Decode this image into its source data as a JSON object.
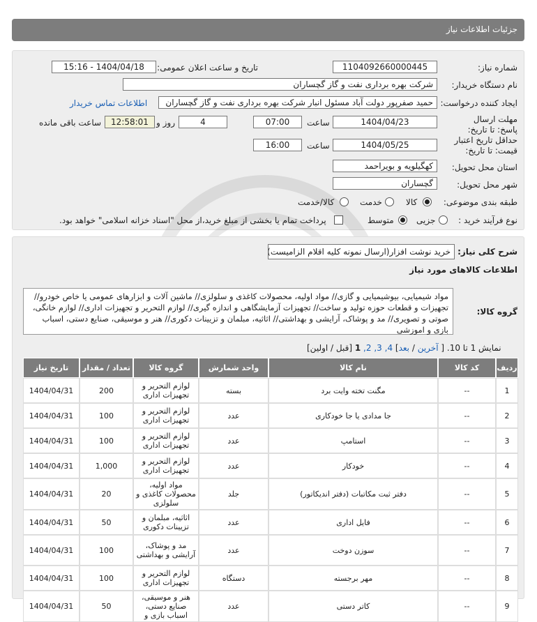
{
  "header": {
    "title": "جزئیات اطلاعات نیاز"
  },
  "form": {
    "need_number_label": "شماره نیاز:",
    "need_number": "1104092660000445",
    "announce_label": "تاریخ و ساعت اعلان عمومی:",
    "announce_value": "1404/04/18 - 15:16",
    "buyer_org_label": "نام دستگاه خریدار:",
    "buyer_org": "شرکت بهره برداری نفت و گاز گچساران",
    "requester_label": "ایجاد کننده درخواست:",
    "requester": "حمید  صفرپور دولت آباد مسئول انبار شرکت بهره برداری نفت و گاز گچساران",
    "buyer_contact_link": "اطلاعات تماس خریدار",
    "reply_deadline_label": "مهلت ارسال پاسخ: تا تاریخ:",
    "reply_date": "1404/04/23",
    "time_label": "ساعت",
    "reply_time": "07:00",
    "days_value": "4",
    "days_label": "روز و",
    "remaining_time": "12:58:01",
    "remaining_label": "ساعت باقی مانده",
    "price_validity_label": "حداقل تاریخ اعتبار قیمت: تا تاریخ:",
    "price_date": "1404/05/25",
    "price_time": "16:00",
    "province_label": "استان محل تحویل:",
    "province": "کهگیلویه و بویراحمد",
    "city_label": "شهر محل تحویل:",
    "city": "گچساران",
    "category_label": "طبقه بندی موضوعی:",
    "category_options": [
      "کالا",
      "خدمت",
      "کالا/خدمت"
    ],
    "category_selected": "کالا",
    "process_label": "نوع فرآیند خرید :",
    "process_options": [
      "جزیی",
      "متوسط"
    ],
    "process_selected": "متوسط",
    "treasury_note": "پرداخت تمام یا بخشی از مبلغ خرید،از محل \"اسناد خزانه اسلامی\" خواهد بود."
  },
  "details": {
    "summary_label": "شرح کلی نیاز:",
    "summary": "خرید نوشت افزار(ارسال نمونه کلیه اقلام الزامیست)",
    "goods_info_title": "اطلاعات کالاهای مورد نیاز",
    "goods_group_label": "گروه کالا:",
    "goods_group": "مواد شیمیایی، بیوشیمیایی و گازی// مواد اولیه، محصولات کاغذی و سلولزی// ماشین آلات و ابزارهای عمومی یا خاص خودرو// تجهیزات و قطعات حوزه تولید و ساخت// تجهیزات آزمایشگاهی و اندازه گیری// لوازم التحریر و تجهیزات اداری// لوازم خانگی، صوتی و تصویری// مد و پوشاک، آرایشی و بهداشتی// اثاثیه، مبلمان و تزیینات دکوری// هنر و موسیقی، صنایع دستی، اسباب بازی و اموزشی"
  },
  "pager": {
    "showing": "نمایش 1 تا 10.",
    "last": "آخرین",
    "next": "بعد",
    "pages": "4, 3, 2,",
    "current": "1",
    "prev_first": "[قبل / اولین]"
  },
  "table": {
    "headers": [
      "ردیف",
      "کد کالا",
      "نام کالا",
      "واحد شمارش",
      "گروه کالا",
      "تعداد / مقدار",
      "تاریخ نیاز"
    ],
    "rows": [
      [
        "1",
        "--",
        "مگنت تخته وایت برد",
        "بسته",
        "لوازم التحریر و تجهیزات اداری",
        "200",
        "1404/04/31"
      ],
      [
        "2",
        "--",
        "جا مدادی یا جا خودکاری",
        "عدد",
        "لوازم التحریر و تجهیزات اداری",
        "100",
        "1404/04/31"
      ],
      [
        "3",
        "--",
        "استامپ",
        "عدد",
        "لوازم التحریر و تجهیزات اداری",
        "100",
        "1404/04/31"
      ],
      [
        "4",
        "--",
        "خودکار",
        "عدد",
        "لوازم التحریر و تجهیزات اداری",
        "1,000",
        "1404/04/31"
      ],
      [
        "5",
        "--",
        "دفتر ثبت مکاتبات (دفتر اندیکاتور)",
        "جلد",
        "مواد اولیه، محصولات کاغذی و سلولزی",
        "20",
        "1404/04/31"
      ],
      [
        "6",
        "--",
        "فایل اداری",
        "عدد",
        "اثاثیه، مبلمان و تزیینات دکوری",
        "50",
        "1404/04/31"
      ],
      [
        "7",
        "--",
        "سوزن دوخت",
        "عدد",
        "مد و پوشاک، آرایشی و بهداشتی",
        "100",
        "1404/04/31"
      ],
      [
        "8",
        "--",
        "مهر برجسته",
        "دستگاه",
        "لوازم التحریر و تجهیزات اداری",
        "100",
        "1404/04/31"
      ],
      [
        "9",
        "--",
        "کاتر دستی",
        "عدد",
        "هنر و موسیقی، صنایع دستی، اسباب بازی و",
        "50",
        "1404/04/31"
      ]
    ]
  }
}
